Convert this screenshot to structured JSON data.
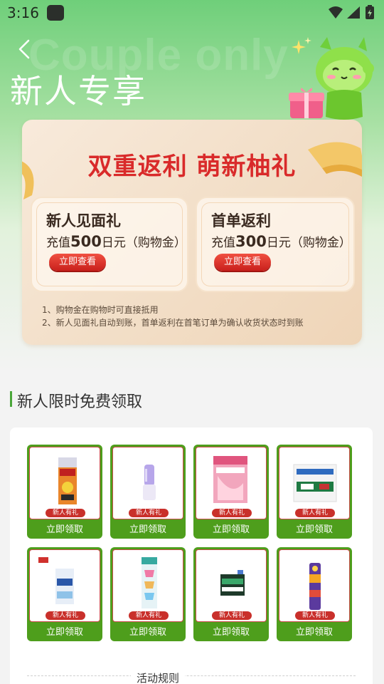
{
  "status_bar": {
    "time": "3:16"
  },
  "header": {
    "watermark": "Couple only",
    "title": "新人专享"
  },
  "promo": {
    "title": "双重返利  萌新柚礼",
    "gifts": [
      {
        "title": "新人见面礼",
        "prefix": "充值",
        "amount": "500",
        "suffix": "日元（购物金）",
        "button": "立即查看"
      },
      {
        "title": "首单返利",
        "prefix": "充值",
        "amount": "300",
        "suffix": "日元（购物金）",
        "button": "立即查看"
      }
    ],
    "notes": [
      "1、购物金在购物时可直接抵用",
      "2、新人见面礼自动到账，首单返利在首笔订单为确认收货状态时到账"
    ]
  },
  "section": {
    "title": "新人限时免费领取"
  },
  "products": [
    {
      "tag": "新人有礼",
      "button": "立即领取"
    },
    {
      "tag": "新人有礼",
      "button": "立即领取"
    },
    {
      "tag": "新人有礼",
      "button": "立即领取"
    },
    {
      "tag": "新人有礼",
      "button": "立即领取"
    },
    {
      "tag": "新人有礼",
      "button": "立即领取"
    },
    {
      "tag": "新人有礼",
      "button": "立即领取"
    },
    {
      "tag": "新人有礼",
      "button": "立即领取"
    },
    {
      "tag": "新人有礼",
      "button": "立即领取"
    }
  ],
  "rules": {
    "label": "活动规则"
  },
  "colors": {
    "brand_green": "#4e9e1c",
    "promo_red": "#d92a2a",
    "tag_red": "#c9302b"
  }
}
